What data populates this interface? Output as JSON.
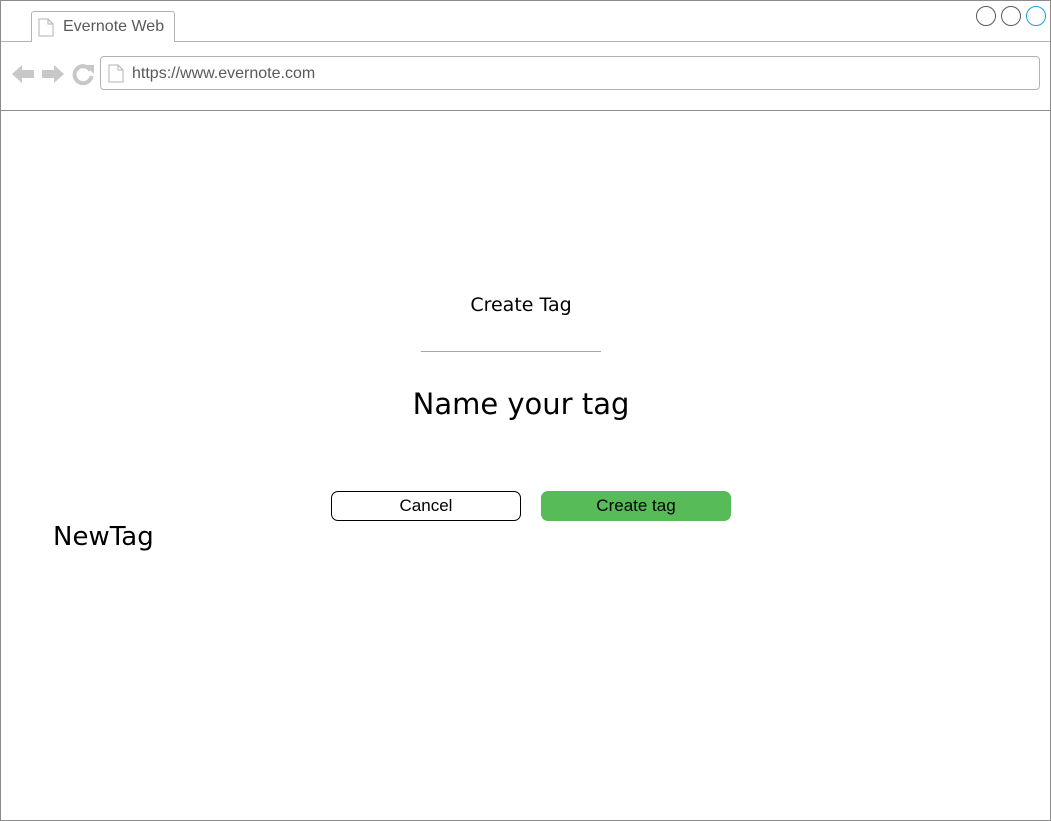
{
  "browser": {
    "tab_title": "Evernote Web",
    "url": "https://www.evernote.com",
    "icons": {
      "page": "page-icon",
      "back": "back-arrow-icon",
      "forward": "forward-arrow-icon",
      "reload": "reload-icon"
    },
    "colors": {
      "chrome_gray": "#cccccc",
      "maximize_accent": "#1f9fd9"
    }
  },
  "dialog": {
    "title": "Create Tag",
    "heading": "Name your tag",
    "cancel_label": "Cancel",
    "create_label": "Create tag",
    "tag_name_value": "NewTag",
    "colors": {
      "create_button": "#57bb57"
    }
  }
}
